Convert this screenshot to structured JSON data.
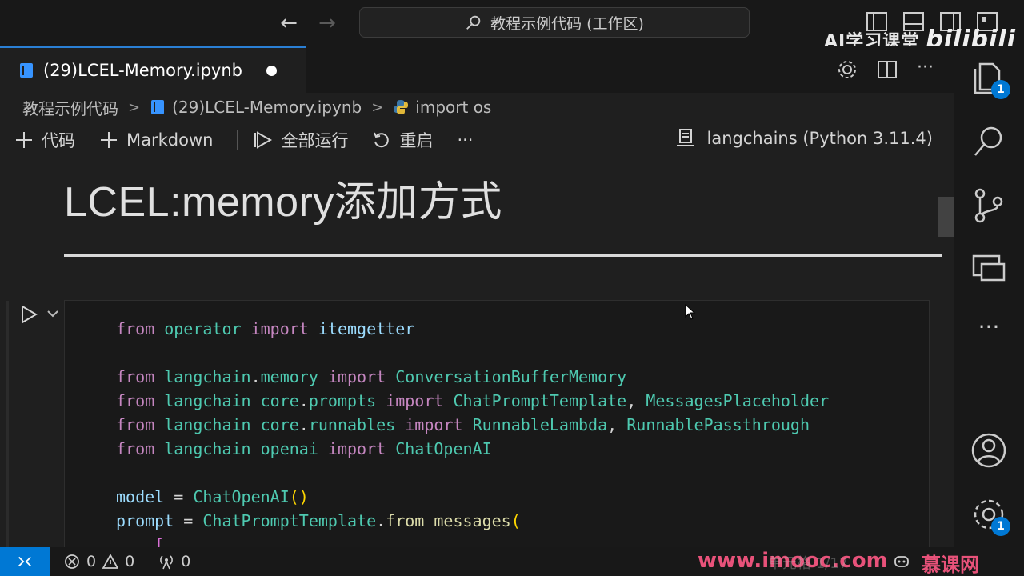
{
  "titlebar": {
    "back_icon": "arrow-left-icon",
    "forward_icon": "arrow-right-icon",
    "search_text": "教程示例代码 (工作区)"
  },
  "watermark": {
    "top_text": "AI学习课堂",
    "top_logo": "bilibili",
    "bottom_site": "www.imooc.com",
    "bottom_partial": "单元格 1/17",
    "bottom_logo": "慕课网"
  },
  "tab": {
    "label": "(29)LCEL-Memory.ipynb"
  },
  "breadcrumb": {
    "folder": "教程示例代码",
    "file": "(29)LCEL-Memory.ipynb",
    "symbol": "import os"
  },
  "toolbar": {
    "add_code": "代码",
    "add_markdown": "Markdown",
    "run_all": "全部运行",
    "restart": "重启",
    "more": "···",
    "kernel": "langchains (Python 3.11.4)"
  },
  "notebook": {
    "heading": "LCEL:memory添加方式"
  },
  "activity": {
    "explorer_badge": "1",
    "settings_badge": "1"
  },
  "status": {
    "errors": "0",
    "warnings": "0",
    "ports": "0"
  },
  "colors": {
    "accent": "#0078d4",
    "keyword": "#c586c0",
    "module": "#4ec9b0",
    "function": "#dcdcaa",
    "variable": "#9cdcfe"
  }
}
